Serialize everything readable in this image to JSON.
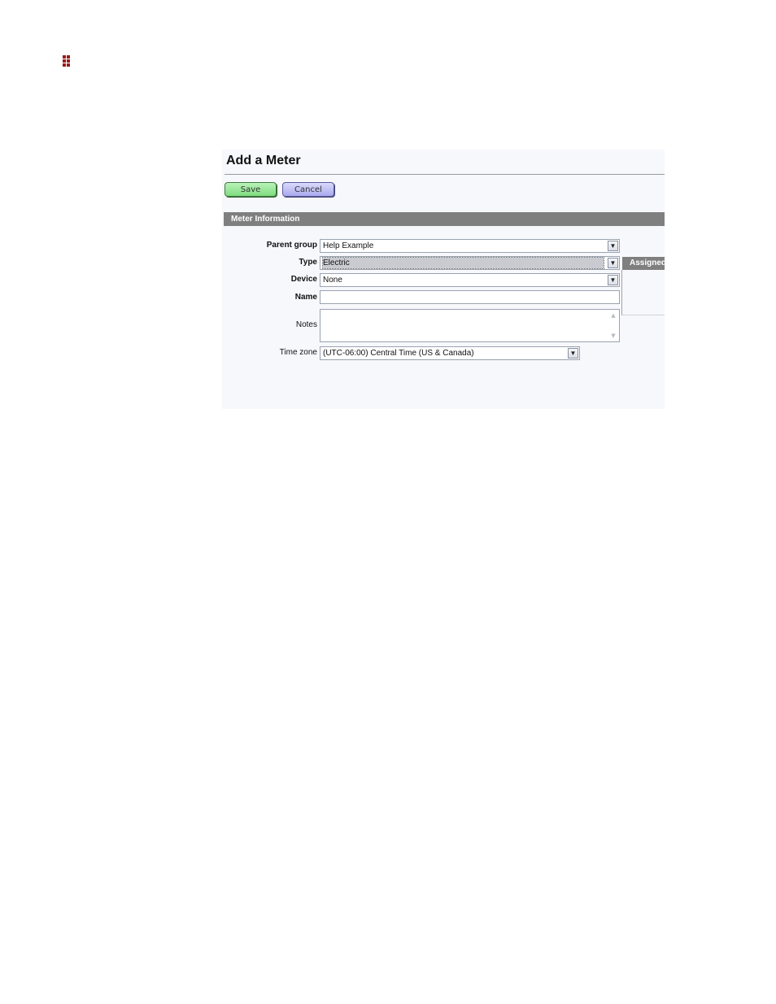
{
  "logo": {
    "icon": "brand-grid-icon",
    "color": "#9b1b1b"
  },
  "page": {
    "title": "Add a Meter",
    "buttons": {
      "save": "Save",
      "cancel": "Cancel"
    },
    "section_title": "Meter Information",
    "side_panel_title": "Assigned"
  },
  "form": {
    "parent_group": {
      "label": "Parent group",
      "value": "Help Example"
    },
    "type": {
      "label": "Type",
      "value": "Electric"
    },
    "device": {
      "label": "Device",
      "value": "None"
    },
    "name": {
      "label": "Name",
      "value": ""
    },
    "notes": {
      "label": "Notes",
      "value": ""
    },
    "time_zone": {
      "label": "Time zone",
      "value": "(UTC-06:00) Central Time (US & Canada)"
    }
  },
  "colors": {
    "save_button": "#8fe38f",
    "cancel_button": "#b8b8f2",
    "section_bar": "#7f7f7f"
  }
}
